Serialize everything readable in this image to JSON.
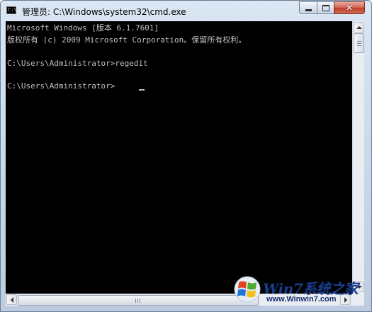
{
  "window": {
    "title": "管理员: C:\\Windows\\system32\\cmd.exe",
    "app_icon_text": "C:\\"
  },
  "caption_buttons": {
    "close_glyph": "✕"
  },
  "console": {
    "lines": [
      "Microsoft Windows [版本 6.1.7601]",
      "版权所有 (c) 2009 Microsoft Corporation。保留所有权利。",
      "",
      "C:\\Users\\Administrator>regedit",
      "",
      "C:\\Users\\Administrator>"
    ],
    "text_color": "#c0c0c0",
    "background": "#000000"
  },
  "watermark": {
    "brand": "Win7系统之家",
    "url": "www.Winwin7.com",
    "brand_color": "#1a3c8c"
  },
  "icons": [
    "cmd-app-icon",
    "minimize-icon",
    "maximize-icon",
    "close-icon",
    "scroll-up-icon",
    "scroll-down-icon",
    "scroll-left-icon",
    "scroll-right-icon",
    "windows-logo-icon"
  ]
}
